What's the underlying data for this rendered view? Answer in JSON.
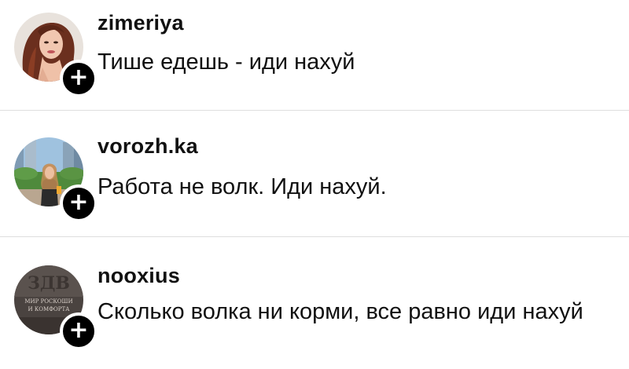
{
  "comments": [
    {
      "username": "zimeriya",
      "text": "Тише едешь - иди нахуй",
      "follow_icon": "plus-icon"
    },
    {
      "username": "vorozh.ka",
      "text": "Работа не волк. Иди нахуй.",
      "follow_icon": "plus-icon"
    },
    {
      "username": "nooxius",
      "text": "Сколько волка ни корми, все равно иди нахуй",
      "follow_icon": "plus-icon",
      "avatar_text": "ЗДВ МИР РОСКОШИ И КОМФОРТА"
    }
  ],
  "follow_symbol": "+",
  "colors": {
    "badge": "#000000",
    "divider": "#dedede",
    "text": "#111111"
  }
}
